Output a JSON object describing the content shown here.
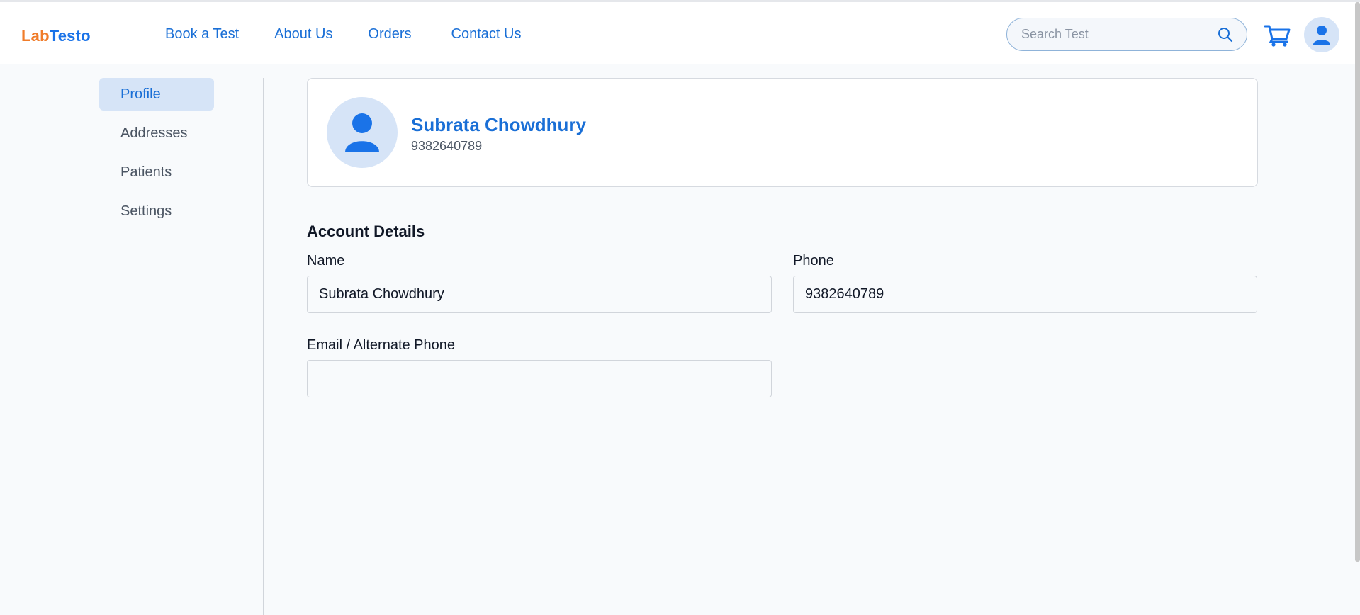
{
  "header": {
    "logo_lab": "Lab",
    "logo_testo": "Testo",
    "nav": [
      "Book a Test",
      "About Us",
      "Orders",
      "Contact Us"
    ],
    "search_placeholder": "Search Test",
    "icons": {
      "search": "search-icon",
      "cart": "cart-icon",
      "account": "user-icon"
    }
  },
  "sidebar": {
    "items": [
      "Profile",
      "Addresses",
      "Patients",
      "Settings"
    ],
    "active": "Profile"
  },
  "profile": {
    "name": "Subrata Chowdhury",
    "phone": "9382640789"
  },
  "account_details": {
    "title": "Account Details",
    "name_label": "Name",
    "name_value": "Subrata Chowdhury",
    "phone_label": "Phone",
    "phone_value": "9382640789",
    "email_label": "Email / Alternate Phone",
    "email_value": ""
  },
  "colors": {
    "primary": "#1a73e8",
    "logo_orange": "#f07c2a",
    "active_bg": "#d6e4f7"
  }
}
